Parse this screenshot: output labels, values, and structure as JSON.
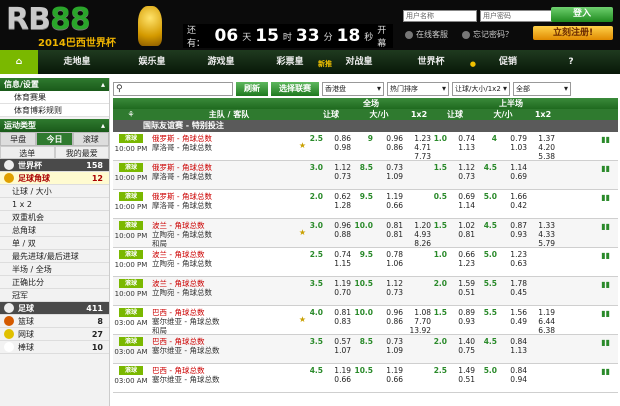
{
  "header": {
    "logo": "RB88",
    "logo_sub": "2014巴西世界杯",
    "countdown": {
      "prefix": "还有：",
      "days": "06",
      "days_u": "天",
      "hours": "15",
      "hours_u": "时",
      "mins": "33",
      "mins_u": "分",
      "secs": "18",
      "secs_u": "秒",
      "suffix": "开幕"
    },
    "username_placeholder": "用户名称",
    "password_placeholder": "用户密码",
    "login_label": "登入",
    "online_label": "在线客服",
    "forgot_label": "忘记密码？",
    "register_label": "立刻注册!"
  },
  "nav": [
    {
      "label": "⌂"
    },
    {
      "label": "走地皇"
    },
    {
      "label": "娱乐皇"
    },
    {
      "label": "游戏皇"
    },
    {
      "label": "彩票皇",
      "badge": "新推"
    },
    {
      "label": "对战皇"
    },
    {
      "label": "世界杯",
      "badge": "●"
    },
    {
      "label": "促销"
    },
    {
      "label": "?"
    }
  ],
  "sidebar": {
    "info_title": "信息/设置",
    "info_items": [
      "体育赛果",
      "体育博彩规则"
    ],
    "sports_title": "运动类型",
    "tabs": [
      "早盘",
      "今日",
      "滚球"
    ],
    "subtabs": [
      "选单",
      "我的最爱"
    ],
    "sports": [
      {
        "name": "世界杯",
        "count": "158",
        "kind": "grp"
      },
      {
        "name": "足球角球",
        "count": "12",
        "kind": "sel"
      },
      {
        "name": "让球 / 大小",
        "count": "",
        "kind": "sub"
      },
      {
        "name": "1 x 2",
        "count": "",
        "kind": "sub"
      },
      {
        "name": "双重机会",
        "count": "",
        "kind": "sub"
      },
      {
        "name": "总角球",
        "count": "",
        "kind": "sub"
      },
      {
        "name": "单 / 双",
        "count": "",
        "kind": "sub"
      },
      {
        "name": "最先进球/最后进球",
        "count": "",
        "kind": "sub"
      },
      {
        "name": "半场 / 全场",
        "count": "",
        "kind": "sub"
      },
      {
        "name": "正确比分",
        "count": "",
        "kind": "sub"
      },
      {
        "name": "冠军",
        "count": "",
        "kind": "sub"
      },
      {
        "name": "足球",
        "count": "411",
        "kind": "grp"
      },
      {
        "name": "篮球",
        "count": "8",
        "kind": "sport",
        "color": "#d45a00"
      },
      {
        "name": "网球",
        "count": "27",
        "kind": "sport",
        "color": "#e0c000"
      },
      {
        "name": "棒球",
        "count": "10",
        "kind": "sport",
        "color": "#fff"
      }
    ]
  },
  "toolbar": {
    "refresh": "刷新",
    "choose": "选择联赛",
    "market": "香港盘",
    "sort": "热门排序",
    "bettype": "让球/大小/1x2",
    "all": "全部"
  },
  "table": {
    "col_team": "主队 / 客队",
    "ft": "全场",
    "ht": "上半场",
    "cols": [
      "让球",
      "大/小",
      "1x2",
      "让球",
      "大/小",
      "1x2"
    ],
    "competition": "国际友谊赛 - 特别投注",
    "live_label": "滚球",
    "rows": [
      {
        "time": "10:00 PM",
        "home": "俄罗斯 - 角球总数",
        "away": "摩洛哥 - 角球总数",
        "draw": "",
        "star": true,
        "hdp": [
          "2.5",
          ""
        ],
        "hdpo": [
          "0.86",
          "0.98"
        ],
        "ou": [
          "9",
          "u"
        ],
        "ouo": [
          "0.96",
          "0.86"
        ],
        "x": [
          "1.23",
          "4.71",
          "7.73"
        ],
        "hhdp": [
          "1.0",
          ""
        ],
        "hhdpo": [
          "0.74",
          "1.13"
        ],
        "hou": [
          "4",
          ""
        ],
        "houo": [
          "0.79",
          "1.03"
        ],
        "hx": [
          "1.37",
          "4.20",
          "5.38"
        ]
      },
      {
        "time": "10:00 PM",
        "home": "俄罗斯 - 角球总数",
        "away": "摩洛哥 - 角球总数",
        "draw": "",
        "star": false,
        "hdp": [
          "3.0",
          ""
        ],
        "hdpo": [
          "1.12",
          "0.73"
        ],
        "ou": [
          "8.5",
          ""
        ],
        "ouo": [
          "0.73",
          "1.09"
        ],
        "x": [
          "",
          "",
          ""
        ],
        "hhdp": [
          "1.5",
          ""
        ],
        "hhdpo": [
          "1.12",
          "0.73"
        ],
        "hou": [
          "4.5",
          ""
        ],
        "houo": [
          "1.14",
          "0.69"
        ],
        "hx": [
          "",
          "",
          ""
        ]
      },
      {
        "time": "10:00 PM",
        "home": "俄罗斯 - 角球总数",
        "away": "摩洛哥 - 角球总数",
        "draw": "",
        "star": false,
        "hdp": [
          "2.0",
          ""
        ],
        "hdpo": [
          "0.62",
          "1.28"
        ],
        "ou": [
          "9.5",
          ""
        ],
        "ouo": [
          "1.19",
          "0.66"
        ],
        "x": [
          "",
          "",
          ""
        ],
        "hhdp": [
          "0.5",
          ""
        ],
        "hhdpo": [
          "0.69",
          "1.14"
        ],
        "hou": [
          "5.0",
          ""
        ],
        "houo": [
          "1.66",
          "0.42"
        ],
        "hx": [
          "",
          "",
          ""
        ]
      },
      {
        "time": "10:00 PM",
        "home": "波兰 - 角球总数",
        "away": "立陶宛 - 角球总数",
        "draw": "和局",
        "star": true,
        "hdp": [
          "3.0",
          ""
        ],
        "hdpo": [
          "0.96",
          "0.88"
        ],
        "ou": [
          "10.0",
          "u"
        ],
        "ouo": [
          "0.81",
          "0.81"
        ],
        "x": [
          "1.20",
          "4.93",
          "8.26"
        ],
        "hhdp": [
          "1.5",
          ""
        ],
        "hhdpo": [
          "1.02",
          "0.81"
        ],
        "hou": [
          "4.5",
          ""
        ],
        "houo": [
          "0.87",
          "0.93"
        ],
        "hx": [
          "1.33",
          "4.33",
          "5.79"
        ]
      },
      {
        "time": "10:00 PM",
        "home": "波兰 - 角球总数",
        "away": "立陶宛 - 角球总数",
        "draw": "",
        "star": false,
        "hdp": [
          "2.5",
          ""
        ],
        "hdpo": [
          "0.74",
          "1.15"
        ],
        "ou": [
          "9.5",
          ""
        ],
        "ouo": [
          "0.78",
          "1.06"
        ],
        "x": [
          "",
          "",
          ""
        ],
        "hhdp": [
          "1.0",
          ""
        ],
        "hhdpo": [
          "0.66",
          "1.23"
        ],
        "hou": [
          "5.0",
          ""
        ],
        "houo": [
          "1.23",
          "0.63"
        ],
        "hx": [
          "",
          "",
          ""
        ]
      },
      {
        "time": "10:00 PM",
        "home": "波兰 - 角球总数",
        "away": "立陶宛 - 角球总数",
        "draw": "",
        "star": false,
        "hdp": [
          "3.5",
          ""
        ],
        "hdpo": [
          "1.19",
          "0.70"
        ],
        "ou": [
          "10.5",
          ""
        ],
        "ouo": [
          "1.12",
          "0.73"
        ],
        "x": [
          "",
          "",
          ""
        ],
        "hhdp": [
          "2.0",
          ""
        ],
        "hhdpo": [
          "1.59",
          "0.51"
        ],
        "hou": [
          "5.5",
          ""
        ],
        "houo": [
          "1.78",
          "0.45"
        ],
        "hx": [
          "",
          "",
          ""
        ]
      },
      {
        "time": "03:00 AM",
        "home": "巴西 - 角球总数",
        "away": "塞尔维亚 - 角球总数",
        "draw": "和局",
        "star": true,
        "hdp": [
          "4.0",
          ""
        ],
        "hdpo": [
          "0.81",
          "0.83"
        ],
        "ou": [
          "10.0",
          "u"
        ],
        "ouo": [
          "0.96",
          "0.86"
        ],
        "x": [
          "1.08",
          "7.70",
          "13.92"
        ],
        "hhdp": [
          "1.5",
          ""
        ],
        "hhdpo": [
          "0.89",
          "0.93"
        ],
        "hou": [
          "5.5",
          ""
        ],
        "houo": [
          "1.56",
          "0.49"
        ],
        "hx": [
          "1.19",
          "6.44",
          "6.38"
        ]
      },
      {
        "time": "03:00 AM",
        "home": "巴西 - 角球总数",
        "away": "塞尔维亚 - 角球总数",
        "draw": "",
        "star": false,
        "hdp": [
          "3.5",
          ""
        ],
        "hdpo": [
          "0.57",
          "1.07"
        ],
        "ou": [
          "8.5",
          ""
        ],
        "ouo": [
          "0.73",
          "1.09"
        ],
        "x": [
          "",
          "",
          ""
        ],
        "hhdp": [
          "2.0",
          ""
        ],
        "hhdpo": [
          "1.40",
          "0.75"
        ],
        "hou": [
          "4.5",
          ""
        ],
        "houo": [
          "0.84",
          "1.13"
        ],
        "hx": [
          "",
          "",
          ""
        ]
      },
      {
        "time": "03:00 AM",
        "home": "巴西 - 角球总数",
        "away": "塞尔维亚 - 角球总数",
        "draw": "",
        "star": false,
        "hdp": [
          "4.5",
          ""
        ],
        "hdpo": [
          "1.19",
          "0.66"
        ],
        "ou": [
          "10.5",
          ""
        ],
        "ouo": [
          "1.19",
          "0.66"
        ],
        "x": [
          "",
          "",
          ""
        ],
        "hhdp": [
          "2.5",
          ""
        ],
        "hhdpo": [
          "1.49",
          "0.51"
        ],
        "hou": [
          "5.0",
          ""
        ],
        "houo": [
          "0.84",
          "0.94"
        ],
        "hx": [
          "",
          "",
          ""
        ]
      }
    ]
  }
}
